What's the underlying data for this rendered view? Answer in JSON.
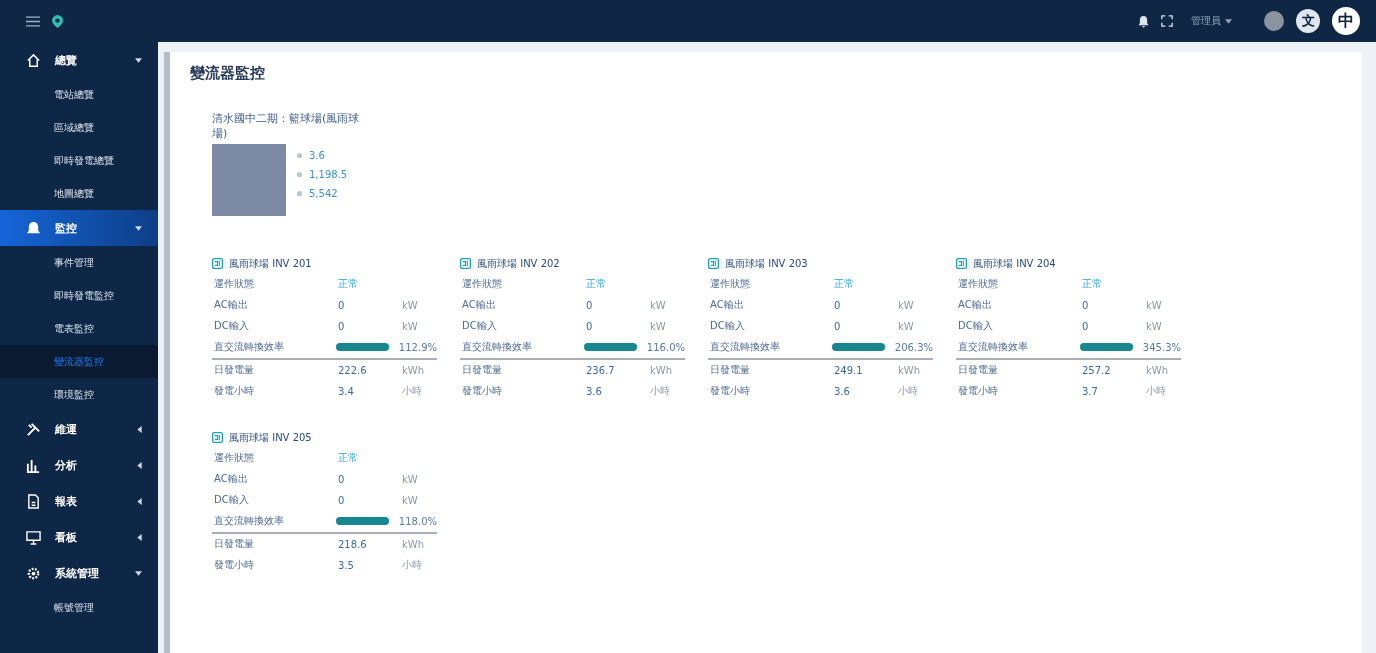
{
  "header": {
    "user": "管理員",
    "languages": [
      {
        "label": "文",
        "selected": false
      },
      {
        "label": "中",
        "selected": true
      }
    ]
  },
  "sidebar": {
    "items": [
      {
        "kind": "group",
        "label": "總覽",
        "expanded": true,
        "selected": false
      },
      {
        "kind": "sub",
        "label": "電站總覽",
        "selected": false
      },
      {
        "kind": "sub",
        "label": "區域總覽",
        "selected": false
      },
      {
        "kind": "sub",
        "label": "即時發電總覽",
        "selected": false
      },
      {
        "kind": "sub",
        "label": "地圖總覽",
        "selected": false
      },
      {
        "kind": "group",
        "label": "監控",
        "expanded": true,
        "selected": true
      },
      {
        "kind": "sub",
        "label": "事件管理",
        "selected": false
      },
      {
        "kind": "sub",
        "label": "即時發電監控",
        "selected": false
      },
      {
        "kind": "sub",
        "label": "電表監控",
        "selected": false
      },
      {
        "kind": "sub",
        "label": "變流器監控",
        "selected": true
      },
      {
        "kind": "sub",
        "label": "環境監控",
        "selected": false
      },
      {
        "kind": "group",
        "label": "維運",
        "expanded": false,
        "selected": false
      },
      {
        "kind": "group",
        "label": "分析",
        "expanded": false,
        "selected": false
      },
      {
        "kind": "group",
        "label": "報表",
        "expanded": false,
        "selected": false
      },
      {
        "kind": "group",
        "label": "看板",
        "expanded": false,
        "selected": false
      },
      {
        "kind": "group",
        "label": "系統管理",
        "expanded": true,
        "selected": false
      },
      {
        "kind": "sub",
        "label": "帳號管理",
        "selected": false
      }
    ]
  },
  "page_title": "變流器監控",
  "site": {
    "name": "清水國中二期：籃球場(風雨球場)",
    "stats": [
      {
        "value": "3.6"
      },
      {
        "value": "1,198.5"
      },
      {
        "value": "5,542"
      }
    ]
  },
  "cards": [
    {
      "title": "風雨球場 INV 201",
      "rows": [
        {
          "kind": "status",
          "label": "運作狀態",
          "value": "正常"
        },
        {
          "kind": "value",
          "label": "AC輸出",
          "value": "0",
          "unit": "kW"
        },
        {
          "kind": "value",
          "label": "DC輸入",
          "value": "0",
          "unit": "kW"
        },
        {
          "kind": "bar",
          "label": "直交流轉換效率",
          "level": 1,
          "value": "112.9%"
        },
        {
          "kind": "value",
          "label": "日發電量",
          "value": "222.6",
          "unit": "kWh"
        },
        {
          "kind": "value",
          "label": "發電小時",
          "value": "3.4",
          "unit": "小時"
        }
      ]
    },
    {
      "title": "風雨球場 INV 202",
      "rows": [
        {
          "kind": "status",
          "label": "運作狀態",
          "value": "正常"
        },
        {
          "kind": "value",
          "label": "AC輸出",
          "value": "0",
          "unit": "kW"
        },
        {
          "kind": "value",
          "label": "DC輸入",
          "value": "0",
          "unit": "kW"
        },
        {
          "kind": "bar",
          "label": "直交流轉換效率",
          "level": 1,
          "value": "116.0%"
        },
        {
          "kind": "value",
          "label": "日發電量",
          "value": "236.7",
          "unit": "kWh"
        },
        {
          "kind": "value",
          "label": "發電小時",
          "value": "3.6",
          "unit": "小時"
        }
      ]
    },
    {
      "title": "風雨球場 INV 203",
      "rows": [
        {
          "kind": "status",
          "label": "運作狀態",
          "value": "正常"
        },
        {
          "kind": "value",
          "label": "AC輸出",
          "value": "0",
          "unit": "kW"
        },
        {
          "kind": "value",
          "label": "DC輸入",
          "value": "0",
          "unit": "kW"
        },
        {
          "kind": "bar",
          "label": "直交流轉換效率",
          "level": 1,
          "value": "206.3%"
        },
        {
          "kind": "value",
          "label": "日發電量",
          "value": "249.1",
          "unit": "kWh"
        },
        {
          "kind": "value",
          "label": "發電小時",
          "value": "3.6",
          "unit": "小時"
        }
      ]
    },
    {
      "title": "風雨球場 INV 204",
      "rows": [
        {
          "kind": "status",
          "label": "運作狀態",
          "value": "正常"
        },
        {
          "kind": "value",
          "label": "AC輸出",
          "value": "0",
          "unit": "kW"
        },
        {
          "kind": "value",
          "label": "DC輸入",
          "value": "0",
          "unit": "kW"
        },
        {
          "kind": "bar",
          "label": "直交流轉換效率",
          "level": 1,
          "value": "345.3%"
        },
        {
          "kind": "value",
          "label": "日發電量",
          "value": "257.2",
          "unit": "kWh"
        },
        {
          "kind": "value",
          "label": "發電小時",
          "value": "3.7",
          "unit": "小時"
        }
      ]
    },
    {
      "title": "風雨球場 INV 205",
      "rows": [
        {
          "kind": "status",
          "label": "運作狀態",
          "value": "正常"
        },
        {
          "kind": "value",
          "label": "AC輸出",
          "value": "0",
          "unit": "kW"
        },
        {
          "kind": "value",
          "label": "DC輸入",
          "value": "0",
          "unit": "kW"
        },
        {
          "kind": "bar",
          "label": "直交流轉換效率",
          "level": 1,
          "value": "118.0%"
        },
        {
          "kind": "value",
          "label": "日發電量",
          "value": "218.6",
          "unit": "kWh"
        },
        {
          "kind": "value",
          "label": "發電小時",
          "value": "3.5",
          "unit": "小時"
        }
      ]
    }
  ]
}
